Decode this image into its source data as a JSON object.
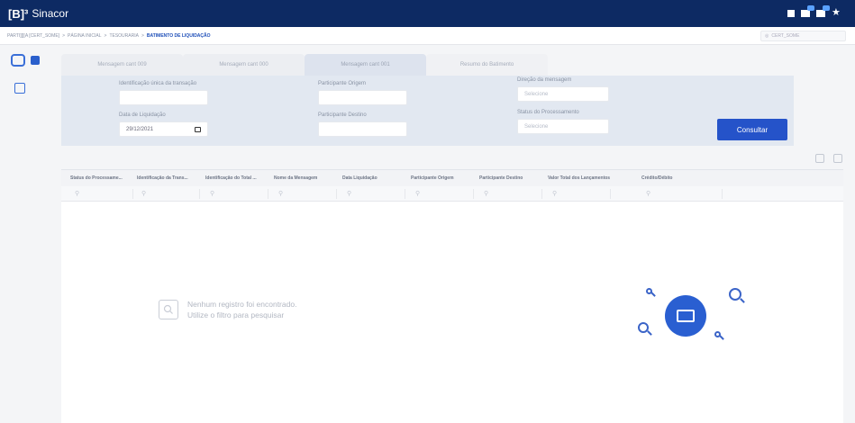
{
  "app": {
    "logo": "[B]³",
    "name": "Sinacor"
  },
  "breadcrumb": {
    "items": [
      "PARTI]]][A [CERT_SOME]",
      "PÁGINA INICIAL",
      "TESOURARIA"
    ],
    "current": "BATIMENTO DE LIQUIDAÇÃO",
    "separator": ">"
  },
  "user_chip": "CERT_SOME",
  "tabs": [
    {
      "label": "Mensagem cant 009",
      "state": "inactive"
    },
    {
      "label": "Mensagem cant 000",
      "state": "inactive"
    },
    {
      "label": "Mensagem cant 001",
      "state": "active"
    },
    {
      "label": "Resumo do Batimento",
      "state": "plain"
    }
  ],
  "filters": {
    "id_label": "Identificação única da transação",
    "id_value": "",
    "origem_label": "Participante Origem",
    "origem_value": "",
    "direcao_label": "Direção da mensagem",
    "direcao_placeholder": "Selecione",
    "data_label": "Data de Liquidação",
    "data_value": "29/12/2021",
    "destino_label": "Participante Destino",
    "destino_value": "",
    "status_label": "Status do Processamento",
    "status_placeholder": "Selecione",
    "consultar_label": "Consultar"
  },
  "grid": {
    "columns": [
      "Status do Processame...",
      "Identificação da Trans...",
      "Identificação do Total ...",
      "Nome da Mensagem",
      "Data Liquidação",
      "Participante Origem",
      "Participante Destino",
      "Valor Total dos Lançamentos",
      "Crédito/Débito"
    ],
    "empty_line1": "Nenhum registro foi encontrado.",
    "empty_line2": "Utilize o filtro para pesquisar"
  },
  "colors": {
    "topbar": "#0d2a63",
    "accent": "#2553c9",
    "filter_bg": "#e2e8f1"
  },
  "icons": [
    "notification-icon",
    "message-icon",
    "star-icon",
    "dashboard-icon",
    "menu-icon",
    "refresh-icon",
    "export-icon",
    "search-icon",
    "calendar-icon"
  ]
}
